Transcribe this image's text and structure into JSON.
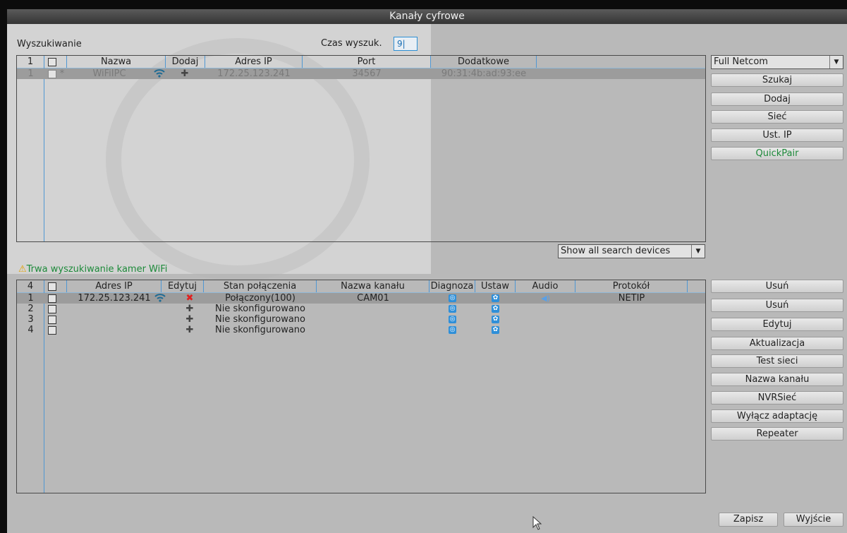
{
  "window": {
    "title": "Kanały cyfrowe"
  },
  "search": {
    "label": "Wyszukiwanie",
    "time_label": "Czas wyszuk.",
    "time_value": "9|",
    "protocol_select": "Full Netcom",
    "filter_select": "Show all search devices",
    "status": "Trwa wyszukiwanie kamer WiFi",
    "table": {
      "count": "1",
      "columns": [
        "Nazwa",
        "Dodaj",
        "Adres IP",
        "Port",
        "Dodatkowe"
      ],
      "rows": [
        {
          "num": "1",
          "star": "*",
          "name": "WiFiIPC",
          "ip": "172.25.123.241",
          "port": "34567",
          "extra": "90:31:4b:ad:93:ee"
        }
      ]
    }
  },
  "search_buttons": [
    "Szukaj",
    "Dodaj",
    "Sieć",
    "Ust. IP",
    "QuickPair"
  ],
  "channels": {
    "count": "4",
    "columns": [
      "Adres IP",
      "Edytuj",
      "Stan połączenia",
      "Nazwa kanału",
      "Diagnoza",
      "Ustaw",
      "Audio",
      "Protokół"
    ],
    "rows": [
      {
        "num": "1",
        "ip": "172.25.123.241",
        "status": "Połączony(100)",
        "name": "CAM01",
        "protocol": "NETIP"
      },
      {
        "num": "2",
        "ip": "",
        "status": "Nie skonfigurowano",
        "name": "",
        "protocol": ""
      },
      {
        "num": "3",
        "ip": "",
        "status": "Nie skonfigurowano",
        "name": "",
        "protocol": ""
      },
      {
        "num": "4",
        "ip": "",
        "status": "Nie skonfigurowano",
        "name": "",
        "protocol": ""
      }
    ]
  },
  "channel_buttons": [
    "Usuń",
    "Usuń",
    "Edytuj",
    "Aktualizacja",
    "Test sieci",
    "Nazwa kanału",
    "NVRSieć",
    "Wyłącz adaptację",
    "Repeater"
  ],
  "footer": {
    "save": "Zapisz",
    "exit": "Wyjście"
  }
}
